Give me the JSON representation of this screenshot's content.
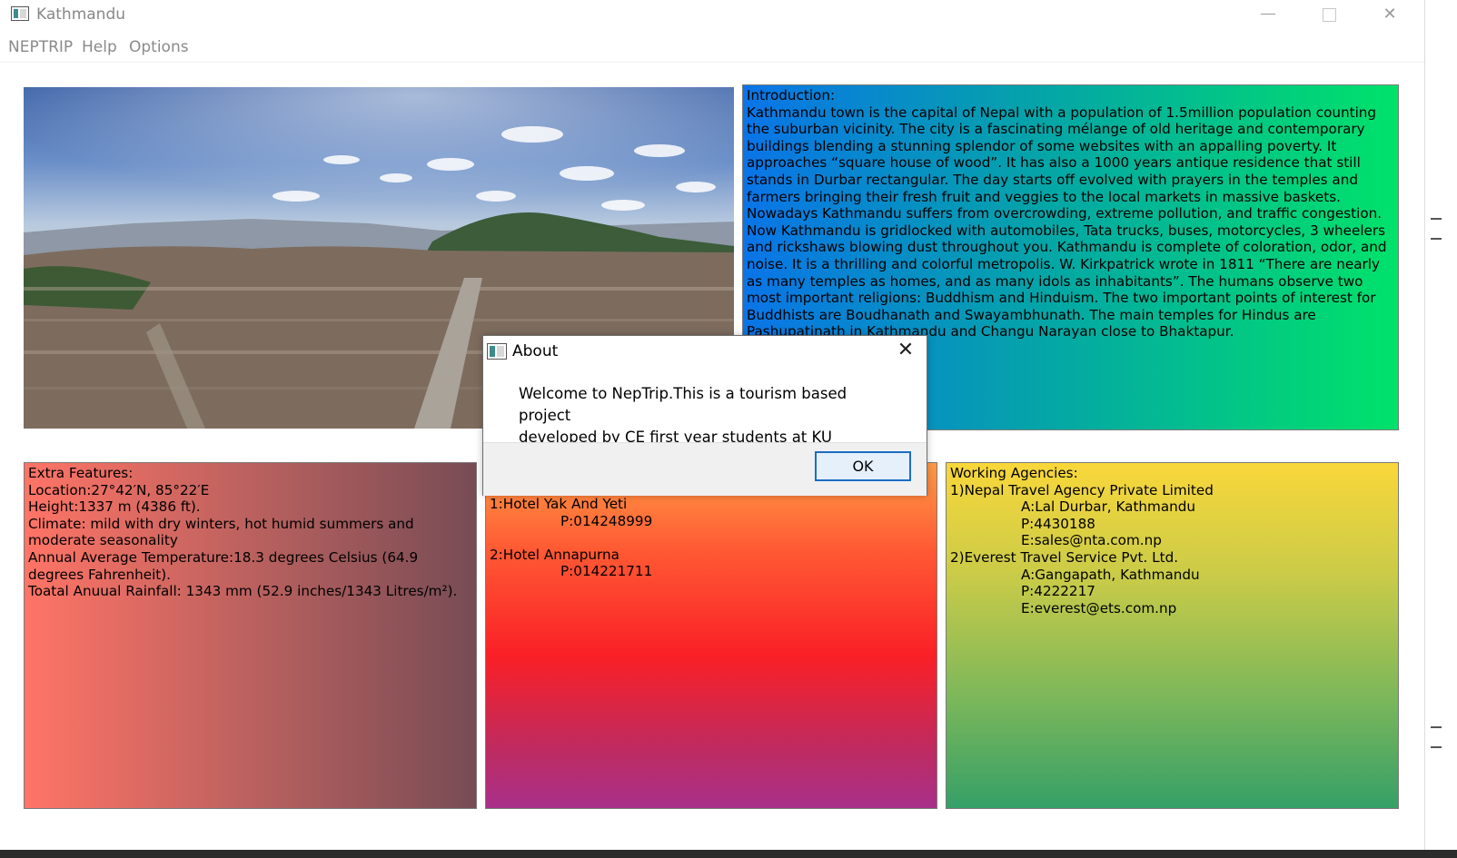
{
  "window": {
    "title": "Kathmandu"
  },
  "menu": [
    "NEPTRIP",
    "Help",
    "Options"
  ],
  "intro": {
    "heading": "Introduction:",
    "text": "Kathmandu town is the capital of Nepal with a population of 1.5million population counting the suburban vicinity. The city is a fascinating mélange of old heritage and contemporary buildings blending a stunning splendor of some websites with an appalling poverty. It approaches “square house of wood”. It has also a 1000 years antique residence that still stands in Durbar rectangular. The day starts off evolved with prayers in the temples and farmers bringing their fresh fruit and veggies to the local markets in massive baskets. Nowadays Kathmandu suffers from overcrowding, extreme pollution, and traffic congestion. Now Kathmandu is gridlocked with automobiles, Tata trucks, buses, motorcycles, 3 wheelers and rickshaws blowing dust throughout you. Kathmandu is complete of coloration, odor, and noise. It is a thrilling and colorful metropolis. W. Kirkpatrick wrote in 1811 “There are nearly as many temples as homes, and as many idols as inhabitants”. The humans observe two most important religions: Buddhism and Hinduism. The two important points of interest for Buddhists are Boudhanath and Swayambhunath. The main temples for Hindus are Pashupatinath in Kathmandu and Changu Narayan close to Bhaktapur."
  },
  "features": {
    "heading": "Extra Features:",
    "location": "Location:27°42′N, 85°22′E",
    "height": "Height:1337 m (4386 ft).",
    "climate": "Climate: mild with dry winters, hot humid summers and moderate seasonality",
    "temperature": "Annual Average Temperature:18.3 degrees Celsius (64.9 degrees Fahrenheit).",
    "rainfall": "Toatal Anuual Rainfall: 1343 mm (52.9 inches/1343 Litres/m²)."
  },
  "hotels": [
    {
      "name": "1:Hotel Yak And Yeti",
      "phone": "P:014248999"
    },
    {
      "name": "2:Hotel Annapurna",
      "phone": "P:014221711"
    }
  ],
  "agencies": {
    "heading": "Working Agencies:",
    "items": [
      {
        "name": "1)Nepal Travel Agency Private Limited",
        "address": "A:Lal Durbar, Kathmandu",
        "phone": "P:4430188",
        "email": "E:sales@nta.com.np"
      },
      {
        "name": "2)Everest Travel Service Pvt. Ltd.",
        "address": "A:Gangapath, Kathmandu",
        "phone": "P:4222217",
        "email": "E:everest@ets.com.np"
      }
    ]
  },
  "dialog": {
    "title": "About",
    "message_line1": "Welcome to NepTrip.This is a tourism based project",
    "message_line2": "developed by CE first year students at KU",
    "ok_label": "OK"
  },
  "icons": {
    "app": "app-window-icon",
    "minimize": "minimize-icon",
    "maximize": "maximize-icon",
    "close": "close-icon"
  }
}
